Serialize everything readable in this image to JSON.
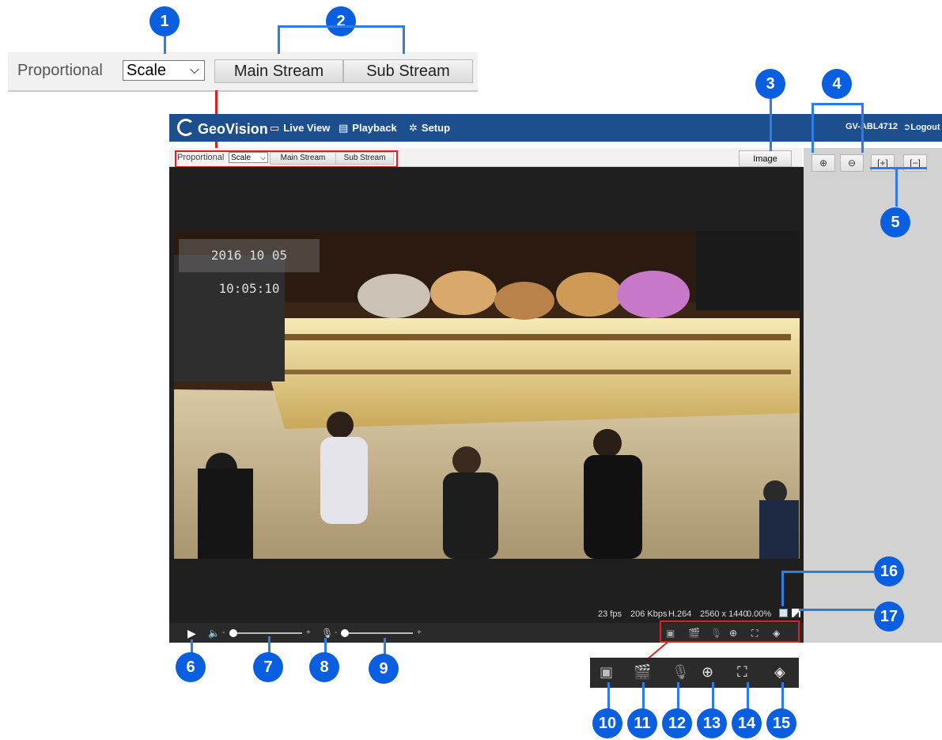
{
  "callout_toolbar": {
    "proportional_label": "Proportional",
    "scale_value": "Scale",
    "main_stream": "Main Stream",
    "sub_stream": "Sub Stream"
  },
  "badges": [
    "1",
    "2",
    "3",
    "4",
    "5",
    "6",
    "7",
    "8",
    "9",
    "10",
    "11",
    "12",
    "13",
    "14",
    "15",
    "16",
    "17"
  ],
  "header": {
    "logo": "GeoVision",
    "nav": [
      {
        "label": "Live View",
        "icon": "monitor-icon",
        "active": true
      },
      {
        "label": "Playback",
        "icon": "film-icon",
        "active": false
      },
      {
        "label": "Setup",
        "icon": "gear-icon",
        "active": false
      }
    ],
    "device": "GV-ABL4712",
    "logout": "Logout"
  },
  "toolbar": {
    "proportional_label": "Proportional",
    "scale_value": "Scale",
    "main_stream": "Main Stream",
    "sub_stream": "Sub Stream",
    "image_button": "Image"
  },
  "zoom_panel": {
    "buttons": [
      {
        "icon": "zoom-in-icon",
        "glyph": "⊕"
      },
      {
        "icon": "zoom-out-icon",
        "glyph": "⊖"
      },
      {
        "icon": "fit-in-icon",
        "glyph": "[+]"
      },
      {
        "icon": "fit-out-icon",
        "glyph": "[−]"
      }
    ]
  },
  "video": {
    "timestamp": "2016 10 05 10:05:10"
  },
  "stats": {
    "fps": "23 fps",
    "bitrate": "206 Kbps",
    "codec": "H.264",
    "resolution": "2560 x 1440",
    "loss": "0.00%"
  },
  "controls": {
    "speaker_volume": 0.0,
    "mic_volume": 0.0
  },
  "icon_strip": [
    "snapshot-icon",
    "record-icon",
    "mic-off-icon",
    "digital-zoom-icon",
    "fullscreen-icon",
    "ptz-icon"
  ],
  "colors": {
    "header": "#1d4f8e",
    "badge": "#0a5ee0",
    "highlight": "#e02020"
  }
}
